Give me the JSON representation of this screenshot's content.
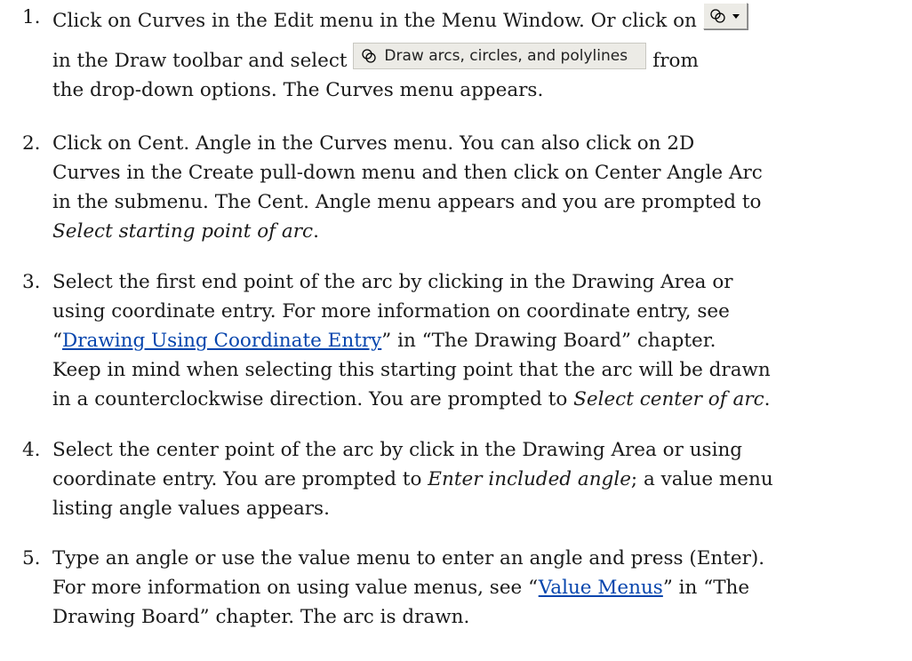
{
  "steps": [
    {
      "number": "1.",
      "l1": "Click on Curves in the Edit menu in the Menu Window. Or click on",
      "l2a": "in the Draw toolbar and select",
      "dropdown_option": "Draw arcs, circles, and polylines",
      "l2b": "from",
      "l3": "the drop-down options. The Curves menu appears.",
      "toolbar_icon": "curves-toolbar-icon"
    },
    {
      "number": "2.",
      "l1": "Click on Cent. Angle in the Curves menu. You can also click on 2D",
      "l2": "Curves in the Create pull-down menu and then click on Center Angle Arc",
      "l3": "in the submenu. The Cent. Angle menu appears and you are prompted to",
      "prompt": "Select starting point of arc",
      "end": "."
    },
    {
      "number": "3.",
      "l1": "Select the first end point of the arc by clicking in the Drawing Area or",
      "l2": "using coordinate entry. For more information on coordinate entry, see",
      "quote_open": "“",
      "link": "Drawing Using Coordinate Entry",
      "l3_rest": "” in “The Drawing Board” chapter.",
      "l4": "Keep in mind when selecting this starting point that the arc will be drawn",
      "l5a": "in a counterclockwise direction. You are prompted to",
      "prompt": "Select center of arc",
      "end": "."
    },
    {
      "number": "4.",
      "l1": "Select the center point of the arc by click in the Drawing Area or using",
      "l2a": "coordinate entry. You are prompted to",
      "prompt": "Enter included angle",
      "l2b": "; a value menu",
      "l3": "listing angle values appears."
    },
    {
      "number": "5.",
      "l1": "Type an angle or use the value menu to enter an angle and press (Enter).",
      "l2a": "For more information on using value menus, see “",
      "link": "Value Menus",
      "l2b": "” in “The",
      "l3": "Drawing Board” chapter. The arc is drawn."
    }
  ]
}
